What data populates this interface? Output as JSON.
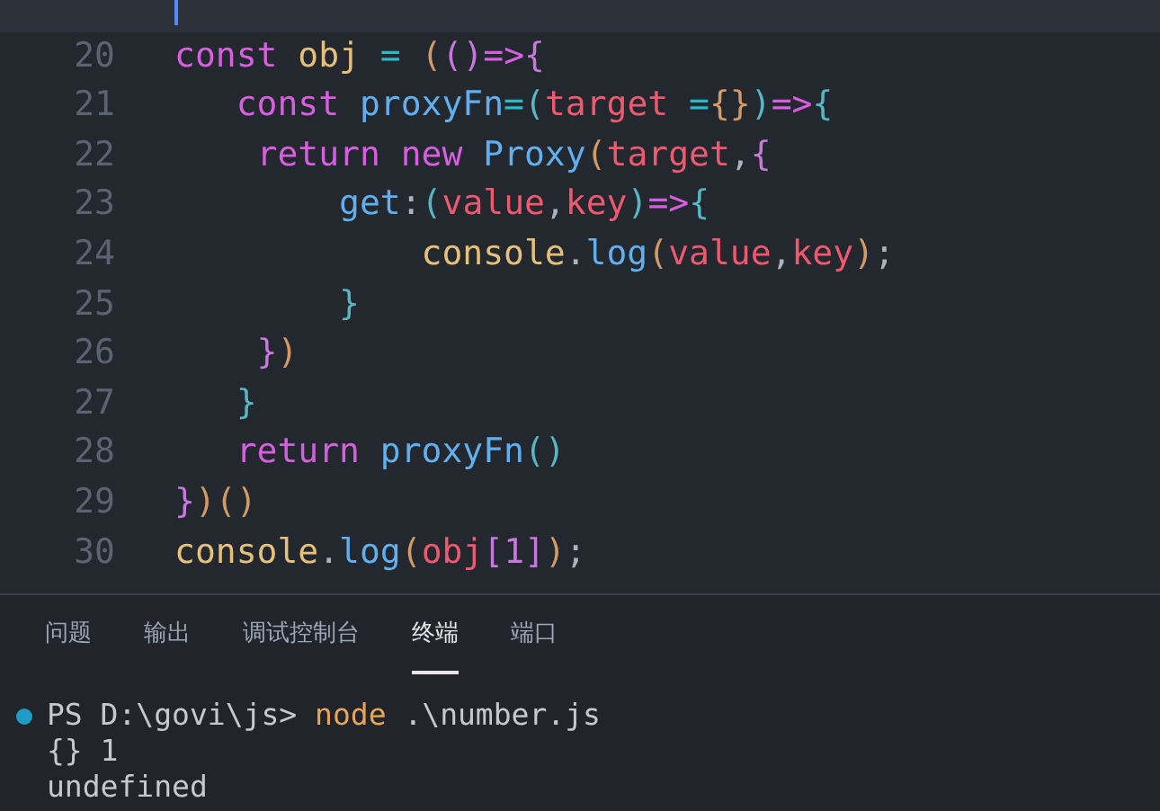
{
  "editor": {
    "lines": [
      {
        "current": true
      },
      {
        "number": "20",
        "current": false,
        "tokens": [
          {
            "text": "const",
            "kind": "keyword"
          },
          {
            "text": " obj",
            "kind": "variable"
          },
          {
            "text": " =",
            "kind": "operator"
          },
          {
            "text": " (",
            "kind": "bracket1"
          },
          {
            "text": "()",
            "kind": "bracket2"
          },
          {
            "text": "=>",
            "kind": "keyword"
          },
          {
            "text": "{",
            "kind": "bracket2"
          }
        ]
      },
      {
        "number": "21",
        "current": false,
        "tokens": [
          {
            "text": "   const",
            "kind": "keyword"
          },
          {
            "text": " proxyFn",
            "kind": "function"
          },
          {
            "text": "=",
            "kind": "operator"
          },
          {
            "text": "(",
            "kind": "bracket3"
          },
          {
            "text": "target",
            "kind": "parameter"
          },
          {
            "text": " =",
            "kind": "operator"
          },
          {
            "text": "{}",
            "kind": "bracket1"
          },
          {
            "text": ")",
            "kind": "bracket3"
          },
          {
            "text": "=>",
            "kind": "keyword"
          },
          {
            "text": "{",
            "kind": "bracket3"
          }
        ]
      },
      {
        "number": "22",
        "current": false,
        "tokens": [
          {
            "text": "    return",
            "kind": "keyword"
          },
          {
            "text": " new",
            "kind": "keyword"
          },
          {
            "text": " Proxy",
            "kind": "function"
          },
          {
            "text": "(",
            "kind": "bracket1"
          },
          {
            "text": "target",
            "kind": "parameter"
          },
          {
            "text": ",",
            "kind": "punctuation"
          },
          {
            "text": "{",
            "kind": "bracket2"
          }
        ]
      },
      {
        "number": "23",
        "current": false,
        "tokens": [
          {
            "text": "        get",
            "kind": "function"
          },
          {
            "text": ":",
            "kind": "punctuation"
          },
          {
            "text": "(",
            "kind": "bracket3"
          },
          {
            "text": "value",
            "kind": "parameter"
          },
          {
            "text": ",",
            "kind": "punctuation"
          },
          {
            "text": "key",
            "kind": "parameter"
          },
          {
            "text": ")",
            "kind": "bracket3"
          },
          {
            "text": "=>",
            "kind": "keyword"
          },
          {
            "text": "{",
            "kind": "bracket3"
          }
        ]
      },
      {
        "number": "24",
        "current": false,
        "tokens": [
          {
            "text": "            console",
            "kind": "variable"
          },
          {
            "text": ".",
            "kind": "punctuation"
          },
          {
            "text": "log",
            "kind": "function"
          },
          {
            "text": "(",
            "kind": "bracket1"
          },
          {
            "text": "value",
            "kind": "parameter"
          },
          {
            "text": ",",
            "kind": "punctuation"
          },
          {
            "text": "key",
            "kind": "parameter"
          },
          {
            "text": ")",
            "kind": "bracket1"
          },
          {
            "text": ";",
            "kind": "punctuation"
          }
        ]
      },
      {
        "number": "25",
        "current": false,
        "tokens": [
          {
            "text": "        }",
            "kind": "bracket3"
          }
        ]
      },
      {
        "number": "26",
        "current": false,
        "tokens": [
          {
            "text": "    }",
            "kind": "bracket2"
          },
          {
            "text": ")",
            "kind": "bracket1"
          }
        ]
      },
      {
        "number": "27",
        "current": false,
        "tokens": [
          {
            "text": "   }",
            "kind": "bracket3"
          }
        ]
      },
      {
        "number": "28",
        "current": false,
        "tokens": [
          {
            "text": "   return",
            "kind": "keyword"
          },
          {
            "text": " proxyFn",
            "kind": "function"
          },
          {
            "text": "()",
            "kind": "bracket3"
          }
        ]
      },
      {
        "number": "29",
        "current": false,
        "tokens": [
          {
            "text": "}",
            "kind": "bracket2"
          },
          {
            "text": ")",
            "kind": "bracket1"
          },
          {
            "text": "()",
            "kind": "bracket1"
          }
        ]
      },
      {
        "number": "30",
        "current": false,
        "tokens": [
          {
            "text": "console",
            "kind": "variable"
          },
          {
            "text": ".",
            "kind": "punctuation"
          },
          {
            "text": "log",
            "kind": "function"
          },
          {
            "text": "(",
            "kind": "bracket1"
          },
          {
            "text": "obj",
            "kind": "parameter"
          },
          {
            "text": "[1]",
            "kind": "bracket2"
          },
          {
            "text": ")",
            "kind": "bracket1"
          },
          {
            "text": ";",
            "kind": "punctuation"
          }
        ]
      }
    ]
  },
  "panel": {
    "tabs": [
      {
        "label": "问题",
        "selected": false
      },
      {
        "label": "输出",
        "selected": false
      },
      {
        "label": "调试控制台",
        "selected": false
      },
      {
        "label": "终端",
        "selected": true
      },
      {
        "label": "端口",
        "selected": false
      }
    ],
    "terminal": {
      "lines": [
        {
          "kind": "prompt",
          "prompt": "PS D:\\govi\\js> ",
          "command": "node",
          "args": " .\\number.js"
        },
        {
          "kind": "output",
          "text": "{} 1"
        },
        {
          "kind": "output",
          "text": "undefined"
        }
      ]
    }
  }
}
